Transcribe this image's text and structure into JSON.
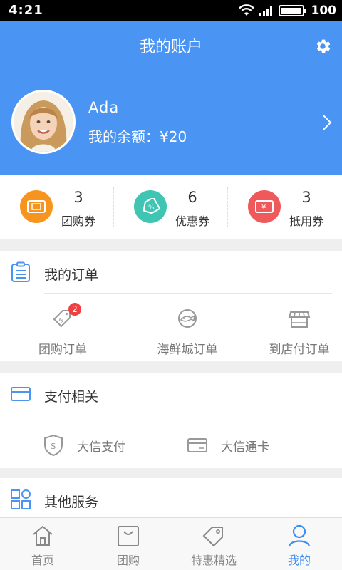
{
  "status_bar": {
    "time": "4:21",
    "battery": "100"
  },
  "header": {
    "title": "我的账户",
    "settings_icon": "gear-icon"
  },
  "profile": {
    "name": "Ada",
    "balance_text": "我的余额：¥20",
    "chevron_icon": "chevron-right-icon"
  },
  "coupons": [
    {
      "count": "3",
      "label": "团购券",
      "color": "#f7941d",
      "icon": "ticket-icon"
    },
    {
      "count": "6",
      "label": "优惠券",
      "color": "#3fc5b2",
      "icon": "discount-tag-icon"
    },
    {
      "count": "3",
      "label": "抵用券",
      "color": "#f0595c",
      "icon": "yuan-ticket-icon"
    }
  ],
  "orders": {
    "title": "我的订单",
    "items": [
      {
        "label": "团购订单",
        "badge": "2"
      },
      {
        "label": "海鲜城订单"
      },
      {
        "label": "到店付订单"
      }
    ]
  },
  "payment": {
    "title": "支付相关",
    "items": [
      {
        "label": "大信支付"
      },
      {
        "label": "大信通卡"
      }
    ]
  },
  "services": {
    "title": "其他服务"
  },
  "tabbar": [
    {
      "label": "首页",
      "active": false
    },
    {
      "label": "团购",
      "active": false
    },
    {
      "label": "特惠精选",
      "active": false
    },
    {
      "label": "我的",
      "active": true
    }
  ],
  "colors": {
    "primary": "#4a95f3",
    "tab_active": "#3a8ef2"
  }
}
